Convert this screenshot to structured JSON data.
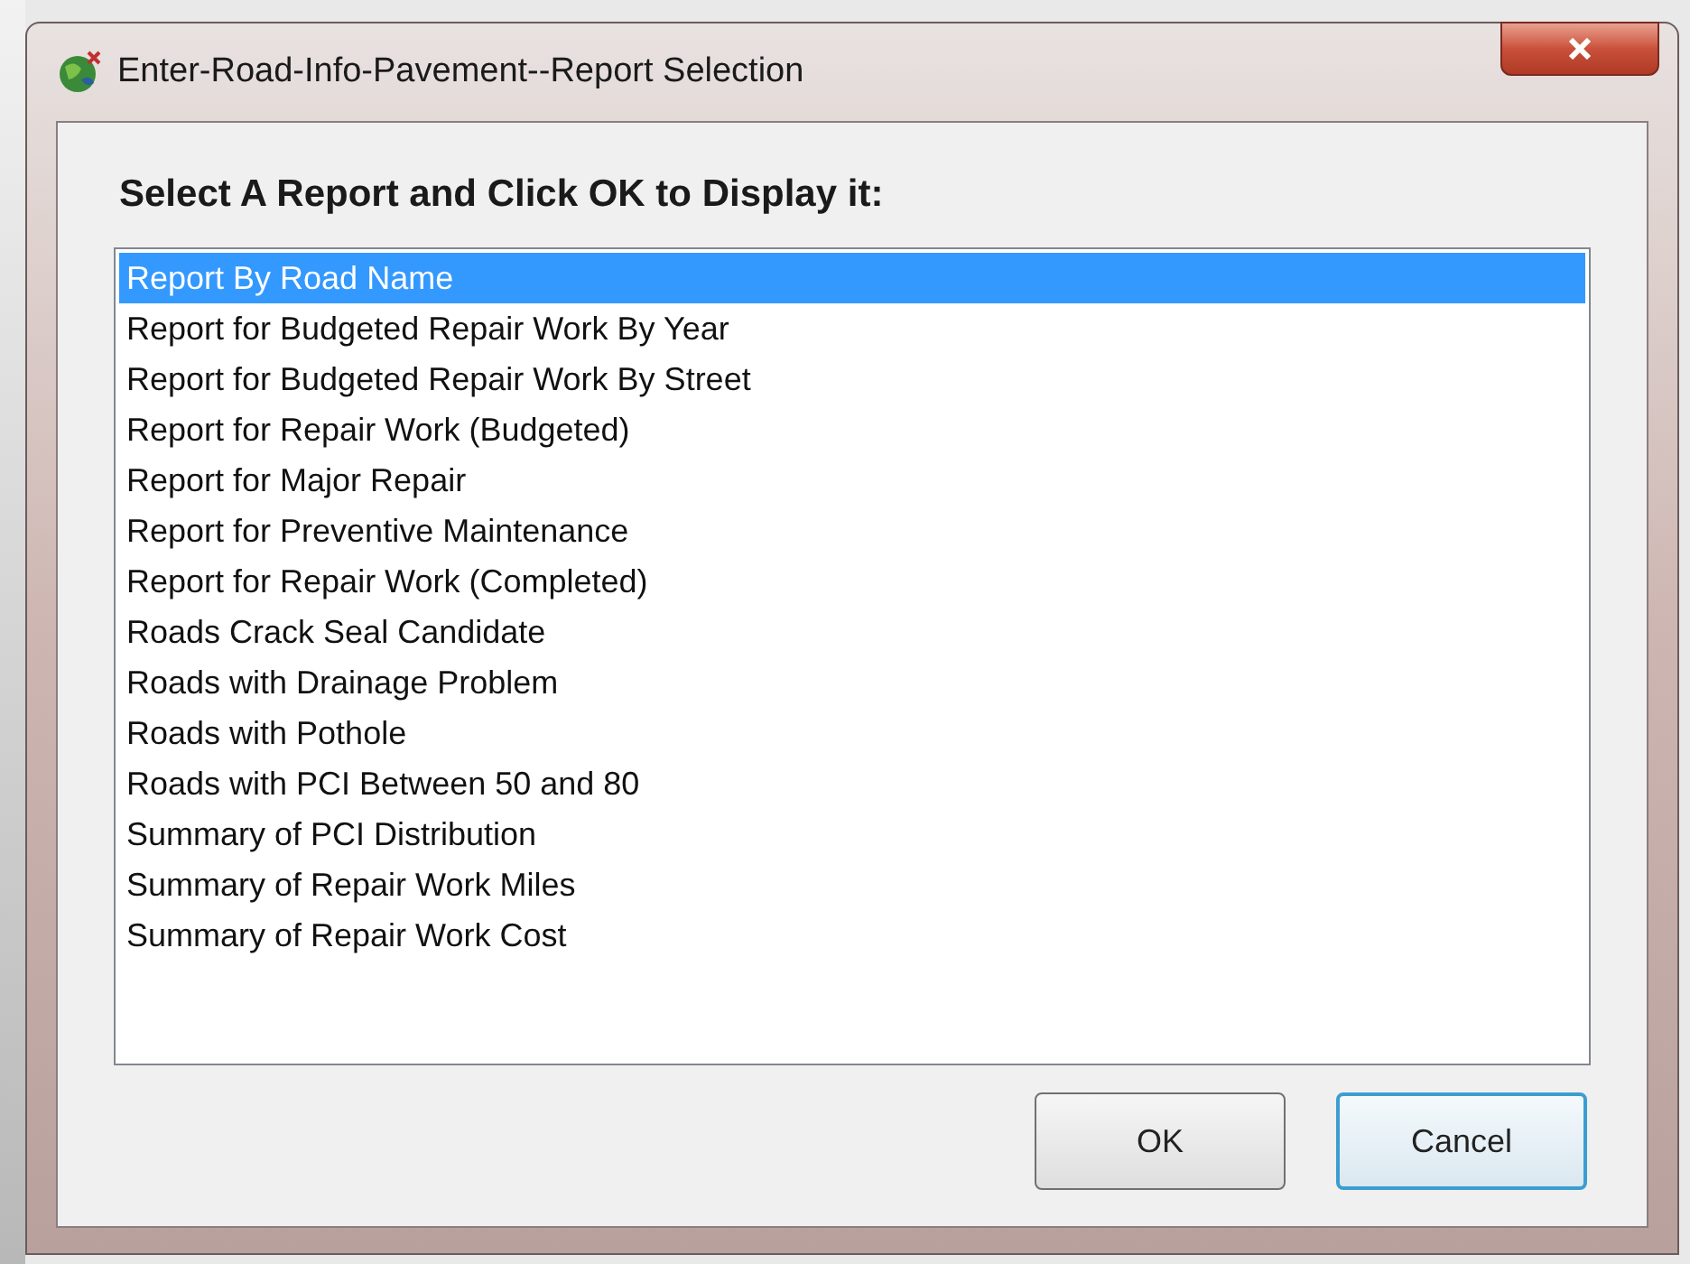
{
  "window": {
    "title": "Enter-Road-Info-Pavement--Report Selection"
  },
  "heading": "Select A Report and Click OK to Display it:",
  "reports": [
    {
      "label": "Report By Road Name",
      "selected": true
    },
    {
      "label": "Report for Budgeted Repair Work By Year",
      "selected": false
    },
    {
      "label": "Report for Budgeted Repair Work By Street",
      "selected": false
    },
    {
      "label": "Report for Repair Work (Budgeted)",
      "selected": false
    },
    {
      "label": "Report for Major Repair",
      "selected": false
    },
    {
      "label": "Report for Preventive Maintenance",
      "selected": false
    },
    {
      "label": "Report for Repair Work (Completed)",
      "selected": false
    },
    {
      "label": "Roads Crack Seal Candidate",
      "selected": false
    },
    {
      "label": "Roads with Drainage Problem",
      "selected": false
    },
    {
      "label": "Roads with Pothole",
      "selected": false
    },
    {
      "label": "Roads with PCI Between 50 and 80",
      "selected": false
    },
    {
      "label": "Summary of PCI Distribution",
      "selected": false
    },
    {
      "label": "Summary of Repair Work Miles",
      "selected": false
    },
    {
      "label": "Summary of Repair Work Cost",
      "selected": false
    }
  ],
  "buttons": [
    {
      "label": "OK",
      "focused": false
    },
    {
      "label": "Cancel",
      "focused": true
    }
  ]
}
